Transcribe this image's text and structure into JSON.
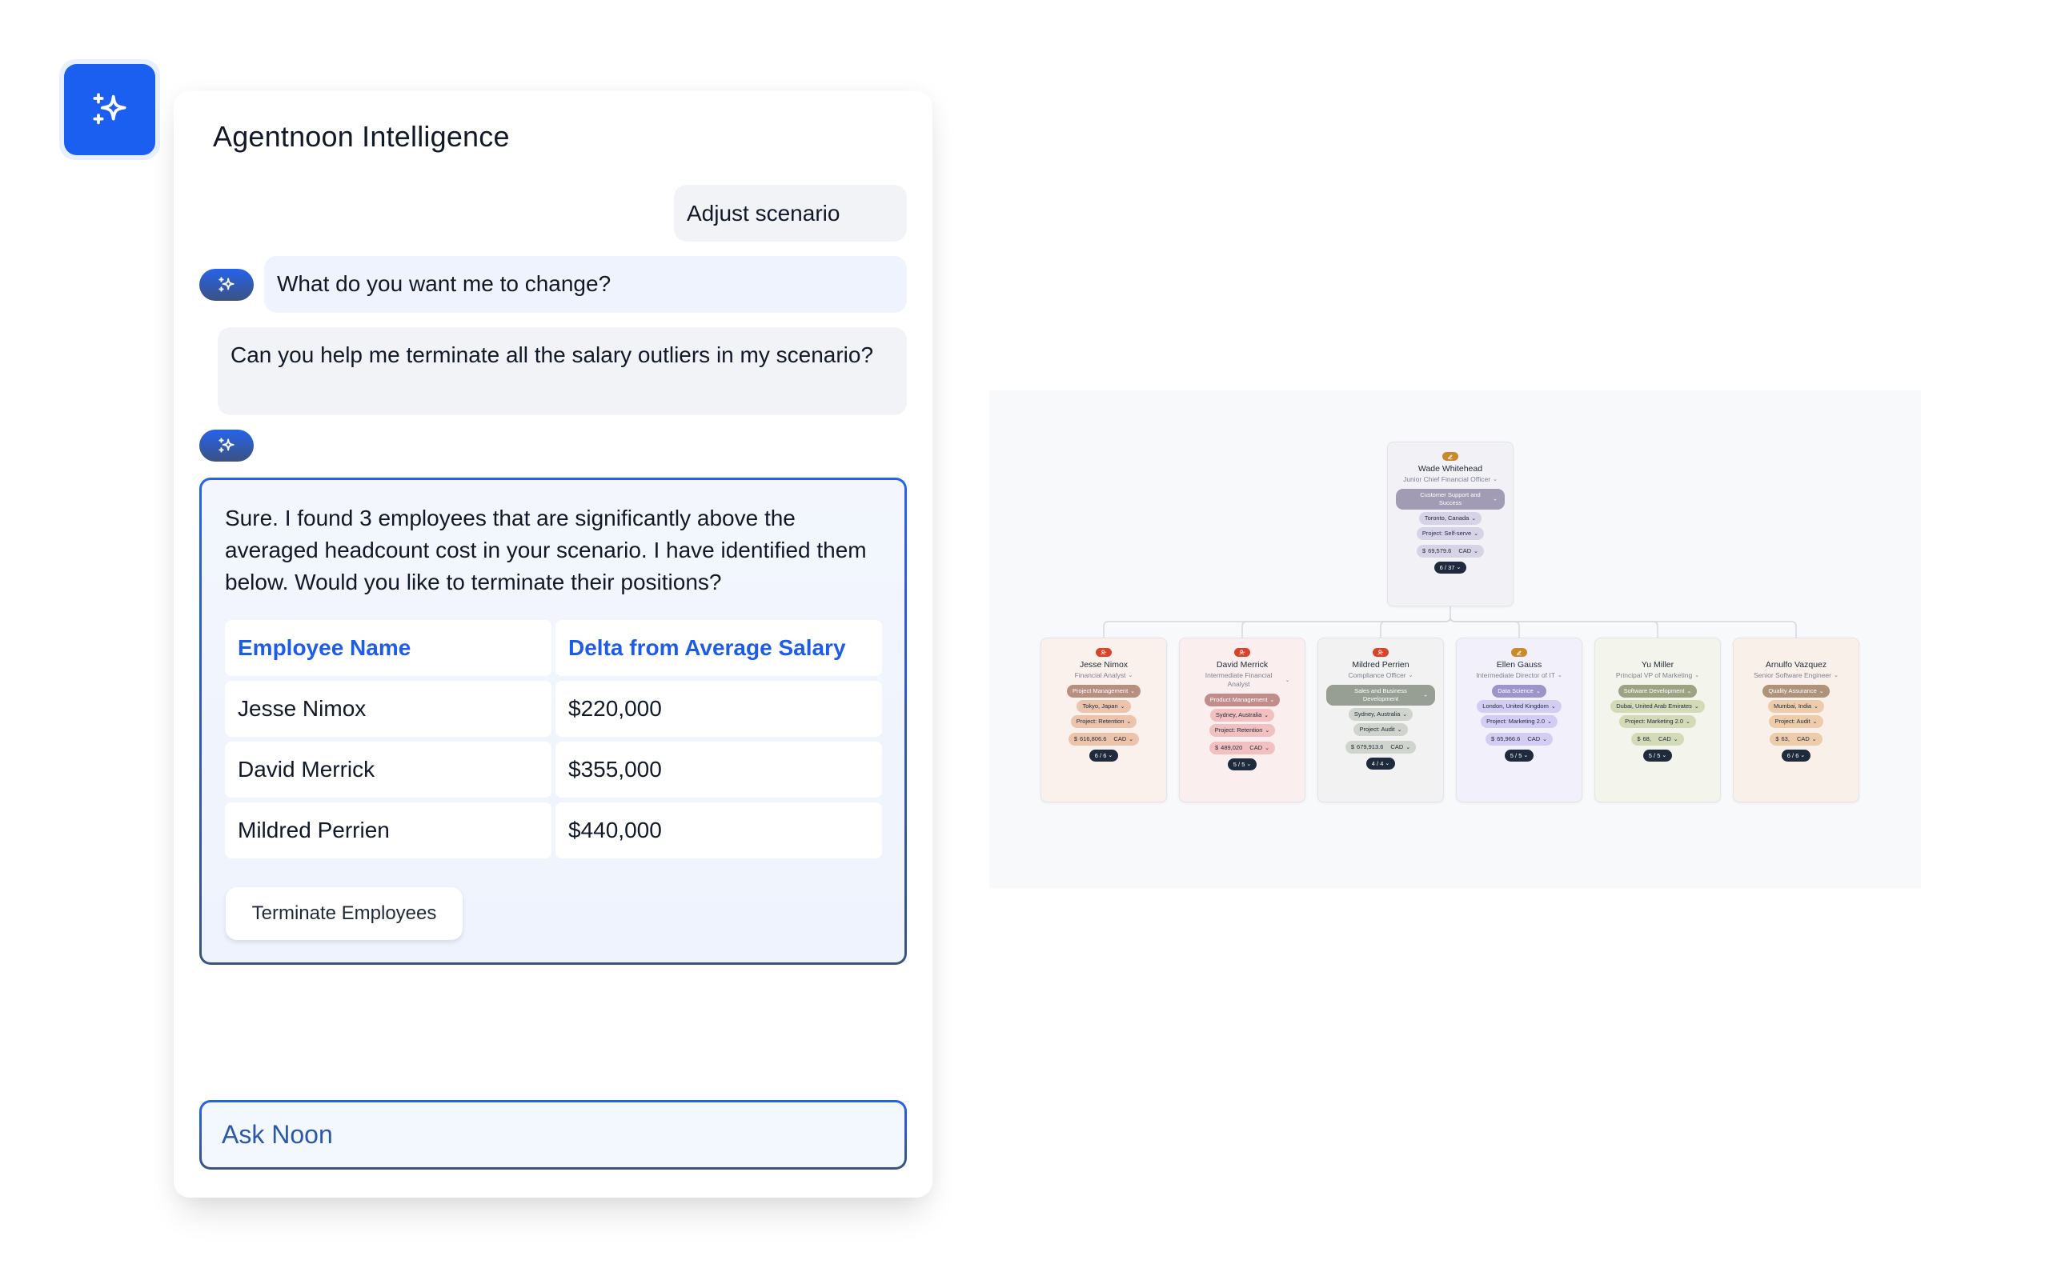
{
  "launcher": {
    "icon": "sparkles-icon",
    "color": "#1a5ff0"
  },
  "panel": {
    "title": "Agentnoon Intelligence",
    "messages": [
      {
        "role": "user",
        "text": "Adjust scenario"
      },
      {
        "role": "assistant",
        "avatar_icon": "sparkles-icon",
        "text": "What do you want me to change?"
      },
      {
        "role": "user",
        "text": "Can you help me terminate all the salary outliers in my scenario?"
      },
      {
        "role": "assistant",
        "avatar_icon": "sparkles-icon"
      }
    ],
    "response": {
      "text": "Sure. I found 3 employees that are significantly above the averaged headcount cost in your scenario. I have identified them below. Would you like to terminate their positions?",
      "table": {
        "headers": [
          "Employee Name",
          "Delta from Average Salary"
        ],
        "rows": [
          [
            "Jesse Nimox",
            "$220,000"
          ],
          [
            "David Merrick",
            "$355,000"
          ],
          [
            "Mildred Perrien",
            "$440,000"
          ]
        ]
      },
      "action_label": "Terminate Employees"
    },
    "input": {
      "placeholder": "Ask Noon",
      "value": ""
    },
    "colors": {
      "accent": "#2563eb",
      "accent_dark": "#3b5282",
      "header_text": "#1d5ce8"
    }
  },
  "org_chart": {
    "root": {
      "status_icon": "edit-icon",
      "status_color": "#c98a2b",
      "name": "Wade Whitehead",
      "role": "Junior Chief Financial Officer",
      "department": "Customer Support and Success",
      "location": "Toronto, Canada",
      "project": "Project: Self-serve",
      "salary_symbol": "$",
      "salary": "69,579.6",
      "currency": "CAD",
      "count": "6 / 37",
      "colors": {
        "bg": "#f2f2f6",
        "dept": "#a19cb3",
        "chip": "#d7d3e6"
      }
    },
    "children": [
      {
        "status_icon": "user-minus-icon",
        "status_color": "#d9432a",
        "name": "Jesse Nimox",
        "role": "Financial Analyst",
        "department": "Project Management",
        "location": "Tokyo, Japan",
        "project": "Project: Retention",
        "salary_symbol": "$",
        "salary": "616,806.6",
        "currency": "CAD",
        "count": "6 / 6",
        "colors": {
          "bg": "#faf0ec",
          "dept": "#b78f7e",
          "chip": "#ecc3ab"
        }
      },
      {
        "status_icon": "user-minus-icon",
        "status_color": "#d9432a",
        "name": "David Merrick",
        "role": "Intermediate Financial Analyst",
        "department": "Product Management",
        "location": "Sydney, Australia",
        "project": "Project: Retention",
        "salary_symbol": "$",
        "salary": "489,020",
        "currency": "CAD",
        "count": "5 / 5",
        "colors": {
          "bg": "#fbeeee",
          "dept": "#c18d8b",
          "chip": "#f2c0c0"
        }
      },
      {
        "status_icon": "user-minus-icon",
        "status_color": "#d9432a",
        "name": "Mildred Perrien",
        "role": "Compliance Officer",
        "department": "Sales and Business Development",
        "location": "Sydney, Australia",
        "project": "Project: Audit",
        "salary_symbol": "$",
        "salary": "679,913.6",
        "currency": "CAD",
        "count": "4 / 4",
        "colors": {
          "bg": "#f1f2f1",
          "dept": "#979e94",
          "chip": "#cfd5cd"
        }
      },
      {
        "status_icon": "edit-icon",
        "status_color": "#c98a2b",
        "name": "Ellen Gauss",
        "role": "Intermediate Director of IT",
        "department": "Data Science",
        "location": "London, United Kingdom",
        "project": "Project: Marketing 2.0",
        "salary_symbol": "$",
        "salary": "65,966.6",
        "currency": "CAD",
        "count": "5 / 5",
        "colors": {
          "bg": "#f2f1fb",
          "dept": "#9d95c9",
          "chip": "#d3cdf3"
        }
      },
      {
        "status_icon": "",
        "name": "Yu Miller",
        "role": "Principal VP of Marketing",
        "department": "Software Development",
        "location": "Dubai, United Arab Emirates",
        "project": "Project: Marketing 2.0",
        "salary_symbol": "$",
        "salary": "68,",
        "currency": "CAD",
        "count": "5 / 5",
        "colors": {
          "bg": "#f3f4ec",
          "dept": "#9ca383",
          "chip": "#d3dab8"
        }
      },
      {
        "status_icon": "",
        "name": "Arnulfo Vazquez",
        "role": "Senior Software Engineer",
        "department": "Quality Assurance",
        "location": "Mumbai, India",
        "project": "Project: Audit",
        "salary_symbol": "$",
        "salary": "63,",
        "currency": "CAD",
        "count": "6 / 6",
        "colors": {
          "bg": "#f9f0e9",
          "dept": "#ae937a",
          "chip": "#ecccaa"
        }
      }
    ]
  }
}
